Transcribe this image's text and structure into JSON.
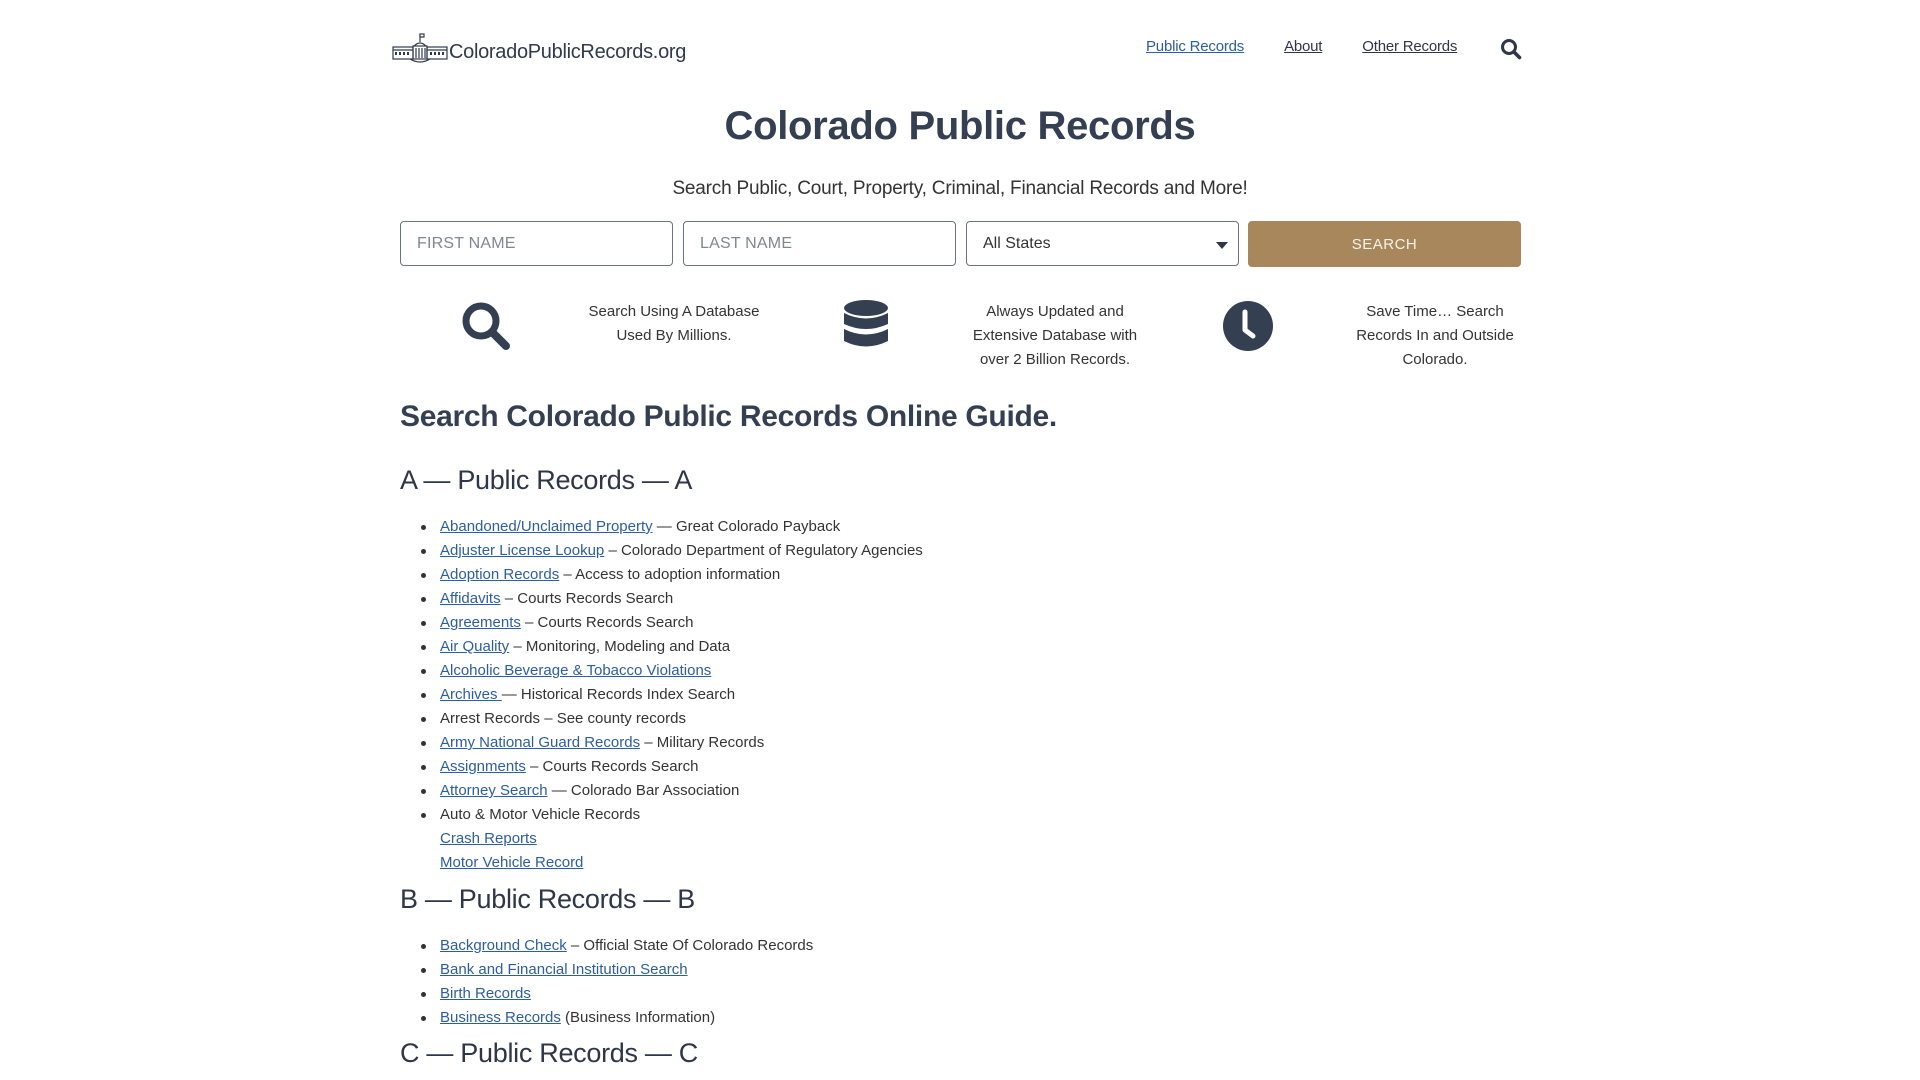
{
  "header": {
    "logo_text": "ColoradoPublicRecords.org",
    "nav": [
      {
        "label": "Public Records",
        "active": true
      },
      {
        "label": "About",
        "active": false
      },
      {
        "label": "Other Records",
        "active": false
      }
    ],
    "search_icon": "search-icon"
  },
  "hero": {
    "title": "Colorado Public Records",
    "subtitle": "Search Public, Court, Property, Criminal, Financial Records and More!"
  },
  "search_form": {
    "first_name_placeholder": "FIRST NAME",
    "last_name_placeholder": "LAST NAME",
    "first_name_value": "",
    "last_name_value": "",
    "state_selected": "All States",
    "submit_label": "SEARCH",
    "button_color": "#a8875d"
  },
  "features": [
    {
      "icon": "search-icon",
      "text_lines": [
        "Search Using A Database",
        "Used By Millions."
      ]
    },
    {
      "icon": "database-icon",
      "text_lines": [
        "Always Updated and",
        "Extensive Database with",
        "over 2 Billion Records."
      ]
    },
    {
      "icon": "clock-icon",
      "text_lines": [
        "Save Time… Search",
        "Records In and Outside",
        "Colorado."
      ]
    }
  ],
  "guide": {
    "title": "Search Colorado Public Records Online Guide.",
    "sections": [
      {
        "heading": "A — Public Records — A",
        "items": [
          {
            "link": "Abandoned/Unclaimed Property",
            "desc": " — Great Colorado Payback"
          },
          {
            "link": "Adjuster License Lookup",
            "desc": " – Colorado Department of Regulatory Agencies"
          },
          {
            "link": "Adoption Records",
            "desc": " – Access to adoption information"
          },
          {
            "link": "Affidavits",
            "desc": " – Courts Records Search"
          },
          {
            "link": "Agreements",
            "desc": " – Courts Records Search"
          },
          {
            "link": "Air Quality",
            "desc": " – Monitoring, Modeling and Data"
          },
          {
            "link": "Alcoholic Beverage & Tobacco Violations",
            "desc": ""
          },
          {
            "link": "Archives ",
            "desc": "—  Historical Records Index Search"
          },
          {
            "link": "",
            "desc": "Arrest Records – See county records"
          },
          {
            "link": "Army National Guard Records",
            "desc": " – Military Records"
          },
          {
            "link": "Assignments",
            "desc": " – Courts Records Search"
          },
          {
            "link": "Attorney Search",
            "desc": " — Colorado Bar Association"
          },
          {
            "link": "",
            "desc": "Auto & Motor Vehicle Records"
          }
        ],
        "sub_links": [
          "Crash Reports",
          "Motor Vehicle Record"
        ]
      },
      {
        "heading": "B — Public Records — B",
        "items": [
          {
            "link": "Background Check",
            "desc": " – Official State Of Colorado Records"
          },
          {
            "link": "Bank and Financial Institution Search",
            "desc": ""
          },
          {
            "link": "Birth Records",
            "desc": ""
          },
          {
            "link": "Business Records",
            "desc": " (Business Information)"
          }
        ]
      },
      {
        "heading": "C — Public Records — C",
        "items": []
      }
    ]
  },
  "colors": {
    "link": "#2c5e9e",
    "heading": "#343f52",
    "accent": "#a8875d"
  }
}
